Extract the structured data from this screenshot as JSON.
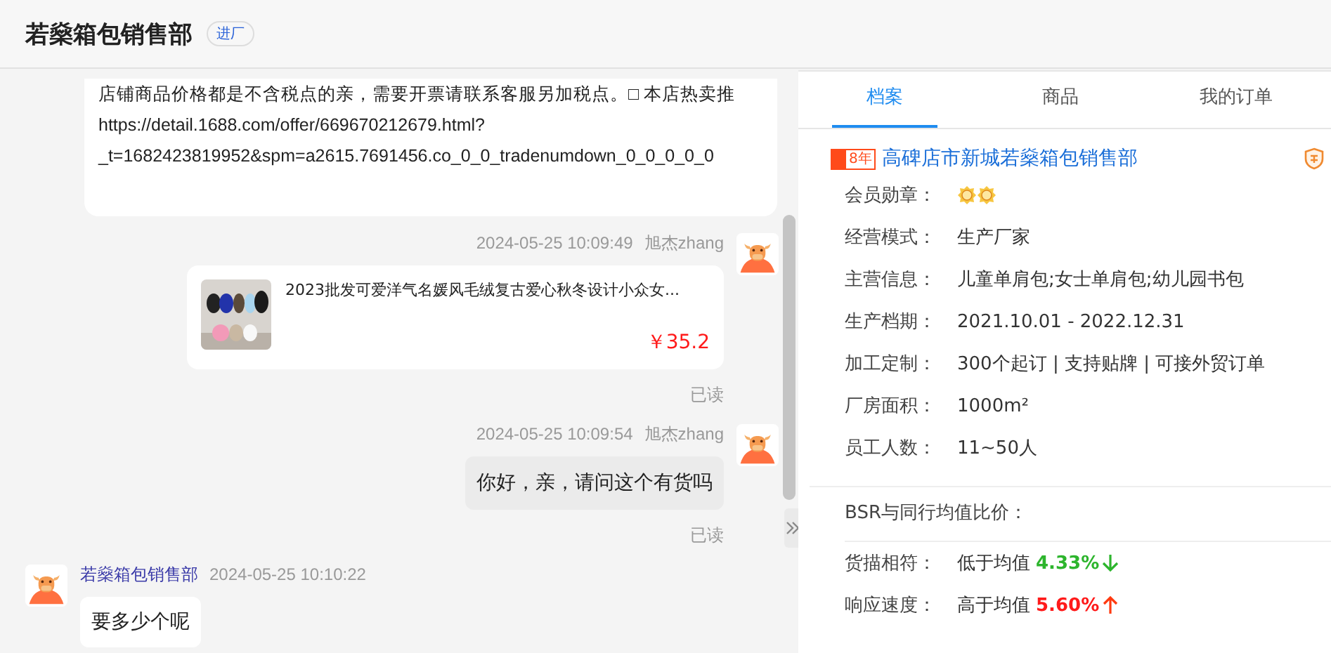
{
  "header": {
    "title": "若燊箱包销售部",
    "badge": "进厂"
  },
  "messages": [
    {
      "kind": "text-cut",
      "lines": [
        "店铺商品价格都是不含税点的亲，需要开票请联系客服另加税点。□ 本店热卖推",
        "https://detail.1688.com/offer/669670212679.html?",
        "_t=1682423819952&spm=a2615.7691456.co_0_0_tradenumdown_0_0_0_0_0"
      ]
    },
    {
      "kind": "product",
      "time": "2024-05-25 10:09:49",
      "sender": "旭杰zhang",
      "title": "2023批发可爱洋气名媛风毛绒复古爱心秋冬设计小众女...",
      "price": "￥35.2",
      "status": "已读"
    },
    {
      "kind": "text",
      "outgoing": true,
      "time": "2024-05-25 10:09:54",
      "sender": "旭杰zhang",
      "text": "你好，亲，请问这个有货吗",
      "status": "已读"
    },
    {
      "kind": "text",
      "outgoing": false,
      "time": "2024-05-25 10:10:22",
      "sender": "若燊箱包销售部",
      "text": "要多少个呢"
    }
  ],
  "tabs": [
    {
      "label": "档案",
      "selected": true
    },
    {
      "label": "商品",
      "selected": false
    },
    {
      "label": "我的订单",
      "selected": false
    }
  ],
  "profile": {
    "years": "8年",
    "company": "高碑店市新城若燊箱包销售部",
    "fields": [
      {
        "label": "会员勋章：",
        "kind": "medals"
      },
      {
        "label": "经营模式：",
        "value": "生产厂家"
      },
      {
        "label": "主营信息：",
        "value": "儿童单肩包;女士单肩包;幼儿园书包"
      },
      {
        "label": "生产档期：",
        "value": "2021.10.01 - 2022.12.31"
      },
      {
        "label": "加工定制：",
        "value": "300个起订 | 支持贴牌 | 可接外贸订单"
      },
      {
        "label": "厂房面积：",
        "value": "1000m²"
      },
      {
        "label": "员工人数：",
        "value": "11~50人"
      }
    ]
  },
  "bsr": {
    "title": "BSR与同行均值比价：",
    "rows": [
      {
        "label": "货描相符：",
        "compare": "低于均值",
        "percent": "4.33%",
        "above_average": false
      },
      {
        "label": "响应速度：",
        "compare": "高于均值",
        "percent": "5.60%",
        "above_average": true
      }
    ]
  }
}
